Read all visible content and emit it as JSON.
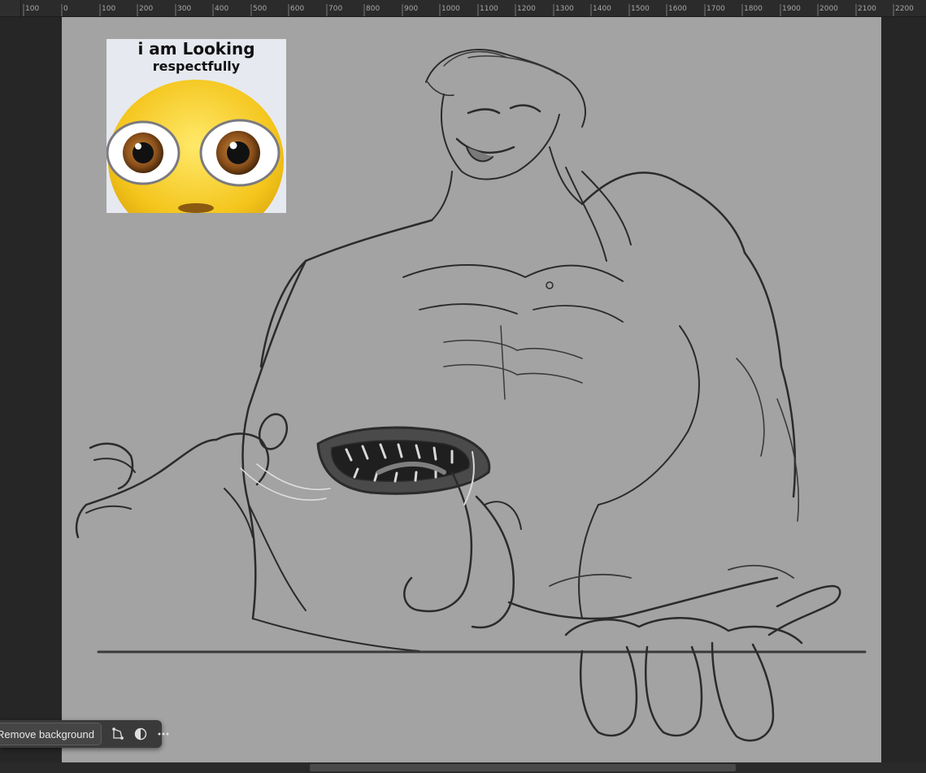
{
  "ruler": {
    "labels": [
      "100",
      "0",
      "100",
      "200",
      "300",
      "400",
      "500",
      "600",
      "700",
      "800",
      "900",
      "1000",
      "1100",
      "1200",
      "1300",
      "1400",
      "1500",
      "1600",
      "1700",
      "1800",
      "1900",
      "2000",
      "2100",
      "2200"
    ]
  },
  "meme": {
    "line1": "i am Looking",
    "line2": "respectfully"
  },
  "taskbar": {
    "remove_bg_label": "Remove background",
    "transform_icon": "transform-crop-icon",
    "adjust_icon": "contrast-adjust-icon",
    "more_icon": "more-ellipsis-icon"
  },
  "colors": {
    "canvas": "#a3a3a3",
    "workspace": "#262626",
    "ruler": "#2b2b2b",
    "taskbar": "#3a3a3a"
  }
}
